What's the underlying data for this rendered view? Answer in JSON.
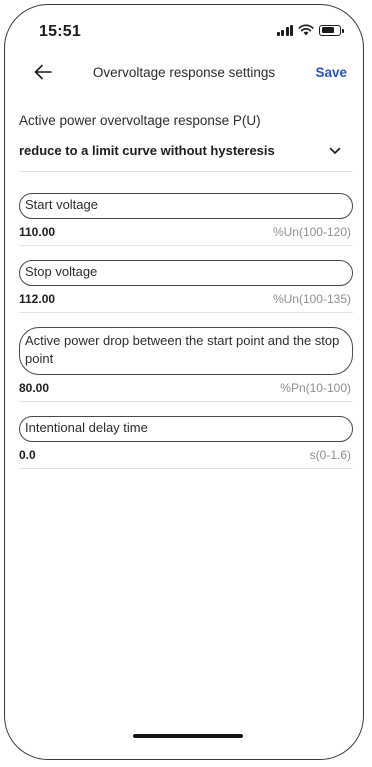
{
  "status_bar": {
    "time": "15:51"
  },
  "nav": {
    "title": "Overvoltage response settings",
    "save_label": "Save"
  },
  "section": {
    "label": "Active power overvoltage response P(U)",
    "selected_mode": "reduce to a limit curve without hysteresis"
  },
  "fields": [
    {
      "label": "Start voltage",
      "value": "110.00",
      "unit": "%Un(100-120)"
    },
    {
      "label": "Stop voltage",
      "value": "112.00",
      "unit": "%Un(100-135)"
    },
    {
      "label": "Active power drop between the start point and the stop point",
      "value": "80.00",
      "unit": "%Pn(10-100)"
    },
    {
      "label": "Intentional delay time",
      "value": "0.0",
      "unit": "s(0-1.6)"
    }
  ]
}
